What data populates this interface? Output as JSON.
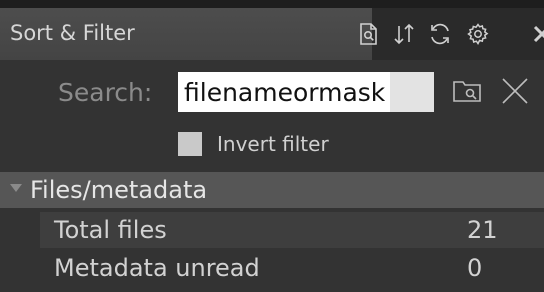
{
  "panel": {
    "title": "Sort & Filter",
    "toolbar_icons": [
      "document-search-icon",
      "sort-icon",
      "refresh-icon",
      "gear-icon",
      "close-icon"
    ]
  },
  "search": {
    "label": "Search:",
    "value": "filenameormask",
    "placeholder": ""
  },
  "invert_filter": {
    "label": "Invert filter",
    "checked": false
  },
  "section": {
    "title": "Files/metadata",
    "expanded": true,
    "rows": [
      {
        "label": "Total files",
        "value": "21"
      },
      {
        "label": "Metadata unread",
        "value": "0"
      }
    ]
  },
  "colors": {
    "background": "#333333",
    "header": "#565656",
    "text": "#d2d2d2"
  }
}
